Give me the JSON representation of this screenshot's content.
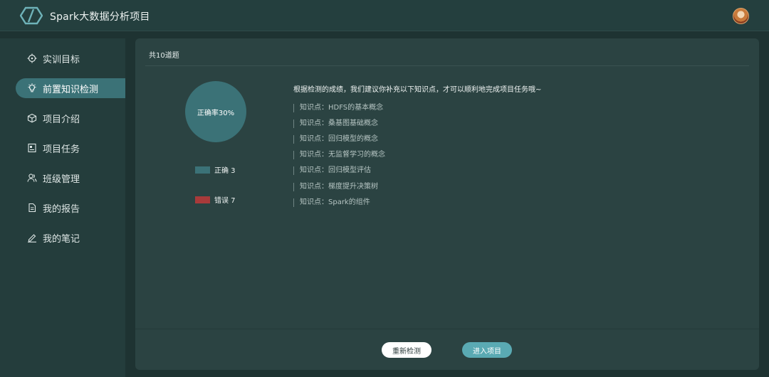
{
  "header": {
    "app_title": "Spark大数据分析项目",
    "logo_icon": "hexagon-slash-logo",
    "avatar_icon": "user-avatar"
  },
  "sidebar": {
    "items": [
      {
        "label": "实训目标",
        "icon": "target-icon",
        "active": false
      },
      {
        "label": "前置知识检测",
        "icon": "lightbulb-icon",
        "active": true
      },
      {
        "label": "项目介绍",
        "icon": "cube-icon",
        "active": false
      },
      {
        "label": "项目任务",
        "icon": "task-icon",
        "active": false
      },
      {
        "label": "班级管理",
        "icon": "users-icon",
        "active": false
      },
      {
        "label": "我的报告",
        "icon": "document-icon",
        "active": false
      },
      {
        "label": "我的笔记",
        "icon": "pencil-icon",
        "active": false
      }
    ]
  },
  "main": {
    "count_label": "共10道题",
    "result": {
      "accuracy_label": "正确率30%",
      "correct_label": "正确 3",
      "wrong_label": "错误 7",
      "correct_count": 3,
      "wrong_count": 7,
      "correct_color": "#3b7277",
      "wrong_color": "#a83a3a"
    },
    "advice": "根据检测的成绩，我们建议你补充以下知识点，才可以顺利地完成项目任务哦~",
    "knowledge_points": [
      "知识点：HDFS的基本概念",
      "知识点：桑基图基础概念",
      "知识点：回归模型的概念",
      "知识点：无监督学习的概念",
      "知识点：回归模型评估",
      "知识点：梯度提升决策树",
      "知识点：Spark的组件"
    ],
    "buttons": {
      "retest": "重新检测",
      "enter": "进入项目"
    }
  },
  "colors": {
    "accent": "#3b7277",
    "button_primary": "#5aaab3",
    "background": "#1e3332",
    "panel": "#2b4342"
  }
}
